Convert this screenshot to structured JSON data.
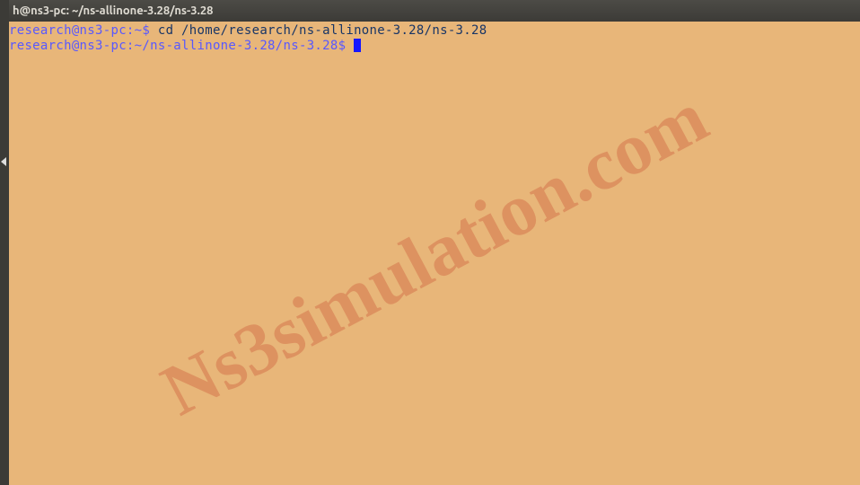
{
  "titlebar": {
    "text": "h@ns3-pc: ~/ns-allinone-3.28/ns-3.28"
  },
  "terminal": {
    "line1": {
      "prompt": "research@ns3-pc:~$",
      "command": " cd /home/research/ns-allinone-3.28/ns-3.28"
    },
    "line2": {
      "prompt": "research@ns3-pc:~/ns-allinone-3.28/ns-3.28$",
      "command": " "
    }
  },
  "watermark": "Ns3simulation.com"
}
